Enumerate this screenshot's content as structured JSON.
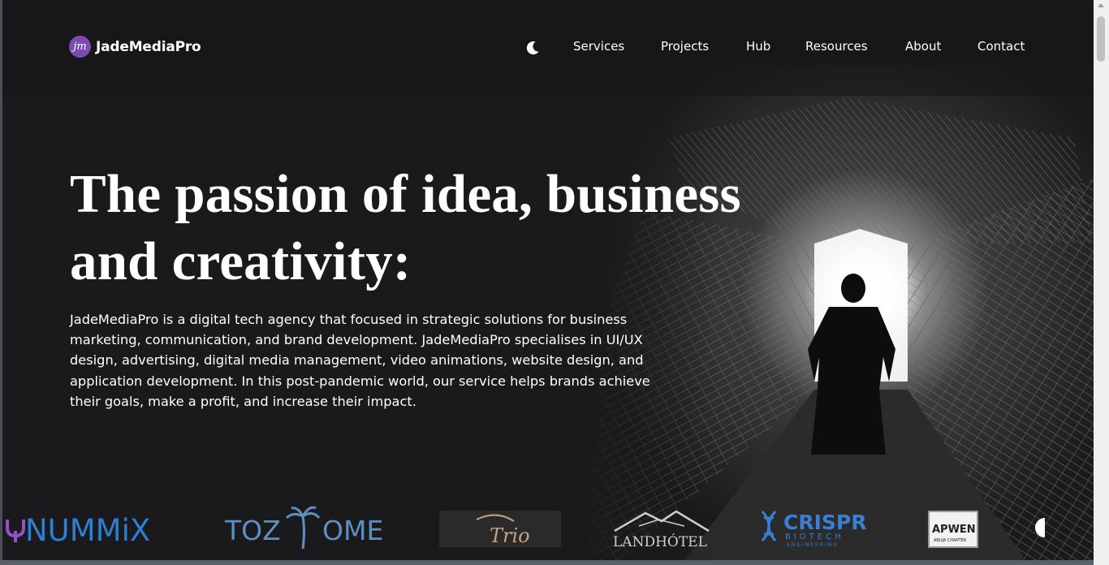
{
  "brand": {
    "name": "JadeMediaPro",
    "mark": "jm"
  },
  "nav": {
    "theme_toggle_icon": "moon-icon",
    "links": [
      "Services",
      "Projects",
      "Hub",
      "Resources",
      "About",
      "Contact"
    ]
  },
  "hero": {
    "headline_line1": "The passion of idea, business",
    "headline_line2": "and creativity:",
    "paragraph": "JadeMediaPro is a digital tech agency that focused in strategic solutions for business marketing, communication, and brand development. JadeMediaPro specialises in UI/UX design, advertising, digital media management, video animations, website design, and application development. In this post-pandemic world, our service helps brands achieve their goals, make a profit, and increase their impact."
  },
  "clients": {
    "nummix": "NUMMiX",
    "tozome_left": "TOZ",
    "tozome_right": "OME",
    "trio": "Trio",
    "landhotel": "LANDHÓTEL",
    "crispr": "CRISPR",
    "crispr_sub": "BIOTECH",
    "crispr_sub2": "ENGINEERING",
    "apwen": "APWEN",
    "apwen_sub": "ABUJA CHAPTER"
  },
  "colors": {
    "background": "#1a1a1c",
    "brand_purple": "#7b4bb1",
    "nummix_blue": "#2f7fd0",
    "tozome_blue": "#5e8fc2",
    "crispr_blue": "#3a7fd6"
  }
}
